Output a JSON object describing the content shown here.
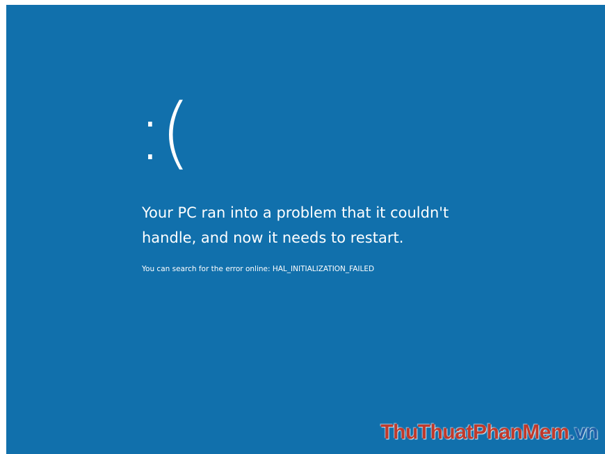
{
  "screen": {
    "background_color": "#1170ac",
    "text_color": "#ffffff",
    "sad_face": ":(",
    "message": "Your PC ran into a problem that it couldn't handle, and now it needs to restart.",
    "search_hint": "You can search for the error online: HAL_INITIALIZATION_FAILED"
  },
  "watermark": {
    "part1": "ThuThuat",
    "part2": "PhanMem",
    "part3": ".vn",
    "colors": [
      "#c0392b",
      "#1f5fa8"
    ]
  }
}
